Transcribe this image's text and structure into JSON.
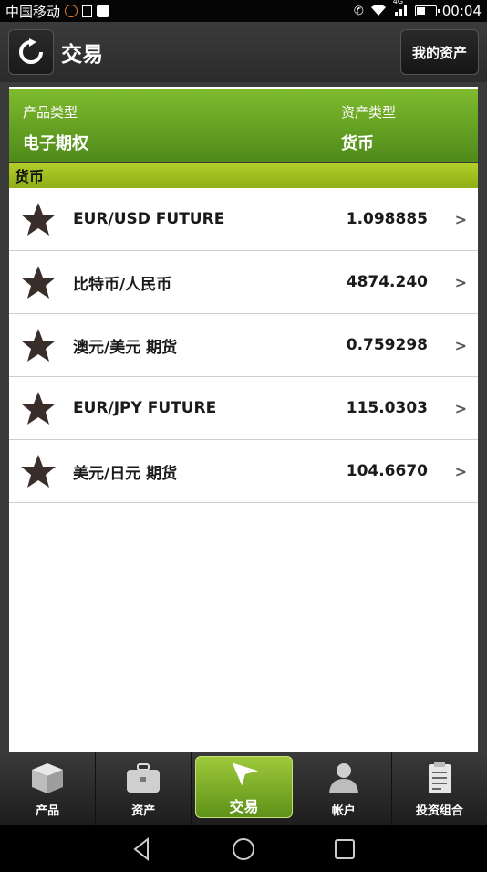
{
  "status_bar": {
    "carrier": "中国移动",
    "network": "4G",
    "time": "00:04"
  },
  "title_bar": {
    "title": "交易",
    "assets_button": "我的资产"
  },
  "filter": {
    "product_type_label": "产品类型",
    "product_type_value": "电子期权",
    "asset_type_label": "资产类型",
    "asset_type_value": "货币"
  },
  "section": {
    "title": "货币"
  },
  "items": [
    {
      "name": "EUR/USD FUTURE",
      "price": "1.098885",
      "arrow": ">"
    },
    {
      "name": "比特币/人民币",
      "price": "4874.240",
      "arrow": ">"
    },
    {
      "name": "澳元/美元 期货",
      "price": "0.759298",
      "arrow": ">"
    },
    {
      "name": "EUR/JPY FUTURE",
      "price": "115.0303",
      "arrow": ">"
    },
    {
      "name": "美元/日元 期货",
      "price": "104.6670",
      "arrow": ">"
    }
  ],
  "tabs": [
    {
      "label": "产品",
      "icon": "box-icon"
    },
    {
      "label": "资产",
      "icon": "briefcase-icon"
    },
    {
      "label": "交易",
      "icon": "send-icon",
      "active": true
    },
    {
      "label": "帐户",
      "icon": "user-icon"
    },
    {
      "label": "投资组合",
      "icon": "clipboard-icon"
    }
  ],
  "colors": {
    "accent_green": "#6ea626",
    "section_yellow_green": "#a8c41f"
  }
}
